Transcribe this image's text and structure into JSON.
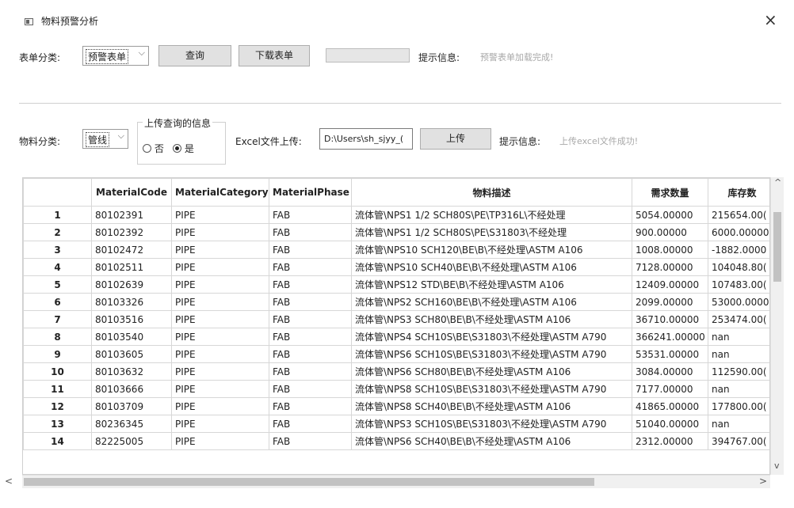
{
  "window": {
    "title": "物料预警分析",
    "close_glyph": "×"
  },
  "top_bar": {
    "form_category_label": "表单分类:",
    "form_category_value": "预警表单",
    "query_button": "查询",
    "download_button": "下载表单",
    "hint_label": "提示信息:",
    "hint_text": "预警表单加载完成!"
  },
  "upload_bar": {
    "material_category_label": "物料分类:",
    "material_category_value": "管线",
    "group_title": "上传查询的信息",
    "radio_no": "否",
    "radio_yes": "是",
    "selected": "是",
    "excel_label": "Excel文件上传:",
    "excel_path": "D:\\Users\\sh_sjyy_(",
    "upload_button": "上传",
    "hint_label": "提示信息:",
    "hint_text": "上传excel文件成功!"
  },
  "table": {
    "columns": [
      "",
      "MaterialCode",
      "MaterialCategory",
      "MaterialPhase",
      "物料描述",
      "需求数量",
      "库存数"
    ],
    "rows": [
      [
        "1",
        "80102391",
        "PIPE",
        "FAB",
        "流体管\\NPS1 1/2 SCH80S\\PE\\TP316L\\不经处理",
        "5054.00000",
        "215654.00("
      ],
      [
        "2",
        "80102392",
        "PIPE",
        "FAB",
        "流体管\\NPS1 1/2 SCH80S\\PE\\S31803\\不经处理",
        "900.00000",
        "6000.00000"
      ],
      [
        "3",
        "80102472",
        "PIPE",
        "FAB",
        "流体管\\NPS10 SCH120\\BE\\B\\不经处理\\ASTM A106",
        "1008.00000",
        "-1882.0000"
      ],
      [
        "4",
        "80102511",
        "PIPE",
        "FAB",
        "流体管\\NPS10 SCH40\\BE\\B\\不经处理\\ASTM A106",
        "7128.00000",
        "104048.80("
      ],
      [
        "5",
        "80102639",
        "PIPE",
        "FAB",
        "流体管\\NPS12 STD\\BE\\B\\不经处理\\ASTM A106",
        "12409.00000",
        "107483.00("
      ],
      [
        "6",
        "80103326",
        "PIPE",
        "FAB",
        "流体管\\NPS2 SCH160\\BE\\B\\不经处理\\ASTM A106",
        "2099.00000",
        "53000.0000"
      ],
      [
        "7",
        "80103516",
        "PIPE",
        "FAB",
        "流体管\\NPS3 SCH80\\BE\\B\\不经处理\\ASTM A106",
        "36710.00000",
        "253474.00("
      ],
      [
        "8",
        "80103540",
        "PIPE",
        "FAB",
        "流体管\\NPS4 SCH10S\\BE\\S31803\\不经处理\\ASTM A790",
        "366241.00000",
        "nan"
      ],
      [
        "9",
        "80103605",
        "PIPE",
        "FAB",
        "流体管\\NPS6 SCH10S\\BE\\S31803\\不经处理\\ASTM A790",
        "53531.00000",
        "nan"
      ],
      [
        "10",
        "80103632",
        "PIPE",
        "FAB",
        "流体管\\NPS6 SCH80\\BE\\B\\不经处理\\ASTM A106",
        "3084.00000",
        "112590.00("
      ],
      [
        "11",
        "80103666",
        "PIPE",
        "FAB",
        "流体管\\NPS8 SCH10S\\BE\\S31803\\不经处理\\ASTM A790",
        "7177.00000",
        "nan"
      ],
      [
        "12",
        "80103709",
        "PIPE",
        "FAB",
        "流体管\\NPS8 SCH40\\BE\\B\\不经处理\\ASTM A106",
        "41865.00000",
        "177800.00("
      ],
      [
        "13",
        "80236345",
        "PIPE",
        "FAB",
        "流体管\\NPS3 SCH10S\\BE\\S31803\\不经处理\\ASTM A790",
        "51040.00000",
        "nan"
      ],
      [
        "14",
        "82225005",
        "PIPE",
        "FAB",
        "流体管\\NPS6 SCH40\\BE\\B\\不经处理\\ASTM A106",
        "2312.00000",
        "394767.00("
      ]
    ]
  },
  "scrollbars": {
    "up_glyph": "^",
    "down_glyph": "v",
    "left_glyph": "<",
    "right_glyph": ">"
  },
  "colors": {
    "hint_text": "#a8a8a8",
    "button_bg": "#e1e1e1",
    "grid_line": "#d7d7d7"
  }
}
